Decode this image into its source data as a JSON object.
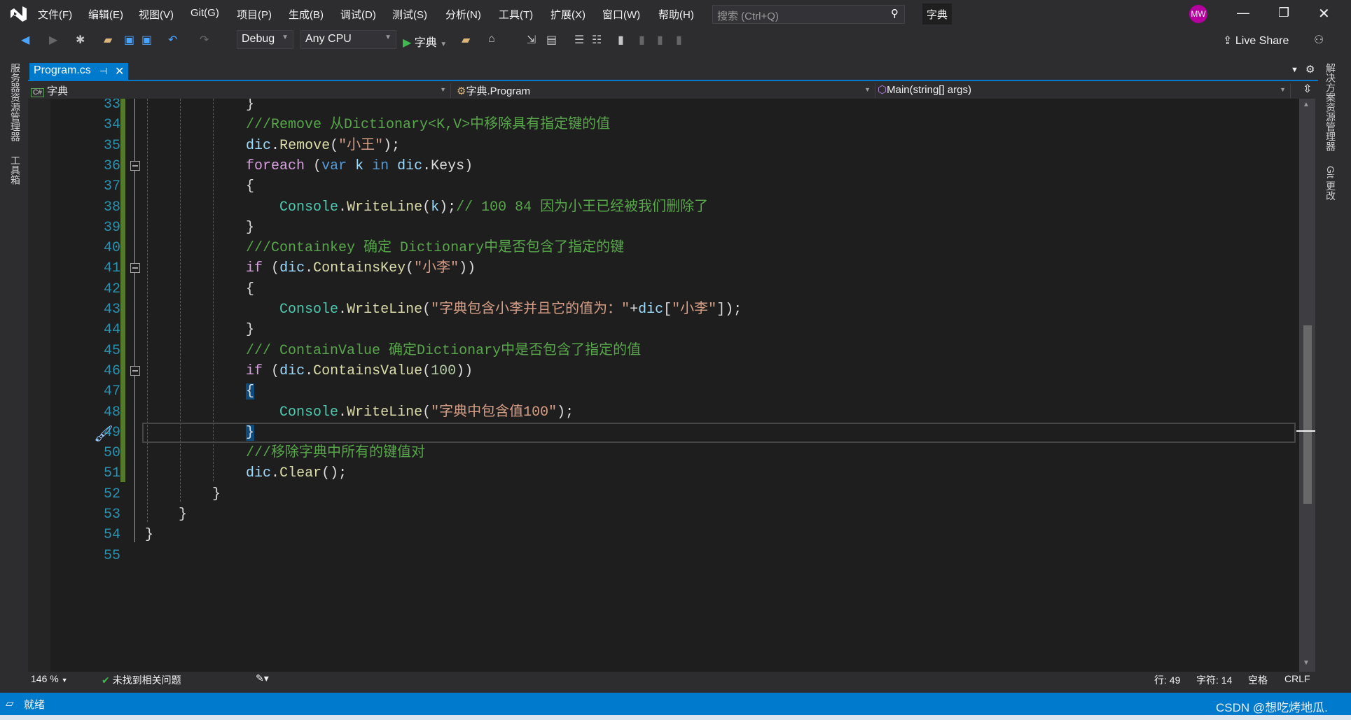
{
  "titlebar": {
    "menus": [
      "文件(F)",
      "编辑(E)",
      "视图(V)",
      "Git(G)",
      "项目(P)",
      "生成(B)",
      "调试(D)",
      "测试(S)",
      "分析(N)",
      "工具(T)",
      "扩展(X)",
      "窗口(W)",
      "帮助(H)"
    ],
    "search_placeholder": "搜索 (Ctrl+Q)",
    "solution_name": "字典",
    "avatar": "MW",
    "avatar_color": "#b4009e"
  },
  "toolbar": {
    "config": "Debug",
    "platform": "Any CPU",
    "start_label": "字典",
    "live_share": "Live Share"
  },
  "side_left": [
    "服务器资源管理器",
    "工具箱"
  ],
  "side_right": [
    "解决方案资源管理器",
    "Git 更改"
  ],
  "tab": {
    "label": "Program.cs",
    "pin": "⊣",
    "close": "✕"
  },
  "navbar": {
    "project": "字典",
    "class": "字典.Program",
    "member": "Main(string[] args)"
  },
  "editor": {
    "first_line": 33,
    "current_line": 49,
    "lines": [
      [
        [
          "            }",
          "plain"
        ]
      ],
      [
        [
          "            ///Remove 从Dictionary<K,V>中移除具有指定键的值",
          "comment"
        ]
      ],
      [
        [
          "            ",
          "plain"
        ],
        [
          "dic",
          "var"
        ],
        [
          ".",
          "plain"
        ],
        [
          "Remove",
          "method"
        ],
        [
          "(",
          "plain"
        ],
        [
          "\"小王\"",
          "string"
        ],
        [
          ");",
          "plain"
        ]
      ],
      [
        [
          "            ",
          "plain"
        ],
        [
          "foreach",
          "ctrl"
        ],
        [
          " (",
          "plain"
        ],
        [
          "var",
          "kw"
        ],
        [
          " ",
          "plain"
        ],
        [
          "k",
          "var"
        ],
        [
          " ",
          "plain"
        ],
        [
          "in",
          "kw"
        ],
        [
          " ",
          "plain"
        ],
        [
          "dic",
          "var"
        ],
        [
          ".Keys)",
          "plain"
        ]
      ],
      [
        [
          "            {",
          "plain"
        ]
      ],
      [
        [
          "                ",
          "plain"
        ],
        [
          "Console",
          "class"
        ],
        [
          ".",
          "plain"
        ],
        [
          "WriteLine",
          "method"
        ],
        [
          "(",
          "plain"
        ],
        [
          "k",
          "var"
        ],
        [
          ");",
          "plain"
        ],
        [
          "// 100 84 因为小王已经被我们删除了",
          "comment"
        ]
      ],
      [
        [
          "            }",
          "plain"
        ]
      ],
      [
        [
          "            ///Containkey 确定 Dictionary中是否包含了指定的键",
          "comment"
        ]
      ],
      [
        [
          "            ",
          "plain"
        ],
        [
          "if",
          "ctrl"
        ],
        [
          " (",
          "plain"
        ],
        [
          "dic",
          "var"
        ],
        [
          ".",
          "plain"
        ],
        [
          "ContainsKey",
          "method"
        ],
        [
          "(",
          "plain"
        ],
        [
          "\"小李\"",
          "string"
        ],
        [
          "))",
          "plain"
        ]
      ],
      [
        [
          "            {",
          "plain"
        ]
      ],
      [
        [
          "                ",
          "plain"
        ],
        [
          "Console",
          "class"
        ],
        [
          ".",
          "plain"
        ],
        [
          "WriteLine",
          "method"
        ],
        [
          "(",
          "plain"
        ],
        [
          "\"字典包含小李并且它的值为：\"",
          "string"
        ],
        [
          "+",
          "plain"
        ],
        [
          "dic",
          "var"
        ],
        [
          "[",
          "plain"
        ],
        [
          "\"小李\"",
          "string"
        ],
        [
          "]);",
          "plain"
        ]
      ],
      [
        [
          "            }",
          "plain"
        ]
      ],
      [
        [
          "            /// ContainValue 确定Dictionary中是否包含了指定的值",
          "comment"
        ]
      ],
      [
        [
          "            ",
          "plain"
        ],
        [
          "if",
          "ctrl"
        ],
        [
          " (",
          "plain"
        ],
        [
          "dic",
          "var"
        ],
        [
          ".",
          "plain"
        ],
        [
          "ContainsValue",
          "method"
        ],
        [
          "(",
          "plain"
        ],
        [
          "100",
          "num"
        ],
        [
          "))",
          "plain"
        ]
      ],
      [
        [
          "            ",
          "plain"
        ],
        [
          "{",
          "hl"
        ]
      ],
      [
        [
          "                ",
          "plain"
        ],
        [
          "Console",
          "class"
        ],
        [
          ".",
          "plain"
        ],
        [
          "WriteLine",
          "method"
        ],
        [
          "(",
          "plain"
        ],
        [
          "\"字典中包含值100\"",
          "string"
        ],
        [
          ");",
          "plain"
        ]
      ],
      [
        [
          "            ",
          "plain"
        ],
        [
          "}",
          "hl"
        ]
      ],
      [
        [
          "            ///移除字典中所有的键值对",
          "comment"
        ]
      ],
      [
        [
          "            ",
          "plain"
        ],
        [
          "dic",
          "var"
        ],
        [
          ".",
          "plain"
        ],
        [
          "Clear",
          "method"
        ],
        [
          "();",
          "plain"
        ]
      ],
      [
        [
          "        }",
          "plain"
        ]
      ],
      [
        [
          "    }",
          "plain"
        ]
      ],
      [
        [
          "}",
          "plain"
        ]
      ],
      [
        [
          "",
          "plain"
        ]
      ]
    ]
  },
  "editor_status": {
    "zoom": "146 %",
    "issues": "未找到相关问题",
    "line": "行: 49",
    "col": "字符: 14",
    "whitespace": "空格",
    "eol": "CRLF"
  },
  "statusbar": {
    "state": "就绪",
    "watermark": "CSDN @想吃烤地瓜."
  }
}
